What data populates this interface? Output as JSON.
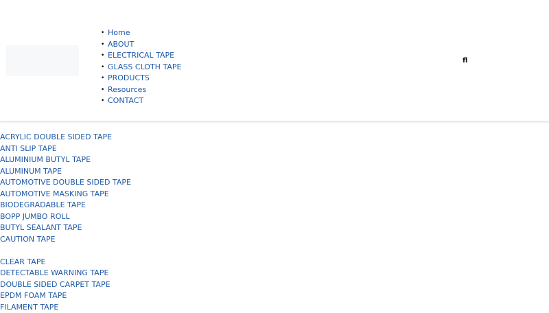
{
  "nav": {
    "items": [
      {
        "label": "Home"
      },
      {
        "label": "ABOUT"
      },
      {
        "label": "ELECTRICAL TAPE"
      },
      {
        "label": "GLASS CLOTH TAPE"
      },
      {
        "label": "PRODUCTS"
      },
      {
        "label": "Resources"
      },
      {
        "label": "CONTACT"
      }
    ],
    "bullet": "•"
  },
  "search": {
    "icon": "search-icon",
    "glyph": "ﬂ"
  },
  "categories": [
    {
      "label": "ACRYLIC DOUBLE SIDED TAPE"
    },
    {
      "label": "ANTI SLIP TAPE"
    },
    {
      "label": "ALUMINIUM BUTYL TAPE"
    },
    {
      "label": "ALUMINUM TAPE"
    },
    {
      "label": "AUTOMOTIVE DOUBLE SIDED TAPE"
    },
    {
      "label": "AUTOMOTIVE MASKING TAPE"
    },
    {
      "label": "BIODEGRADABLE TAPE"
    },
    {
      "label": "BOPP JUMBO ROLL"
    },
    {
      "label": "BUTYL SEALANT TAPE"
    },
    {
      "label": "CAUTION TAPE"
    },
    {
      "label": "CLEAR TAPE"
    },
    {
      "label": "DETECTABLE WARNING TAPE"
    },
    {
      "label": "DOUBLE SIDED CARPET TAPE"
    },
    {
      "label": "EPDM FOAM TAPE"
    },
    {
      "label": "FILAMENT TAPE"
    }
  ],
  "colors": {
    "link": "#1e5aa8",
    "background": "#ffffff"
  }
}
